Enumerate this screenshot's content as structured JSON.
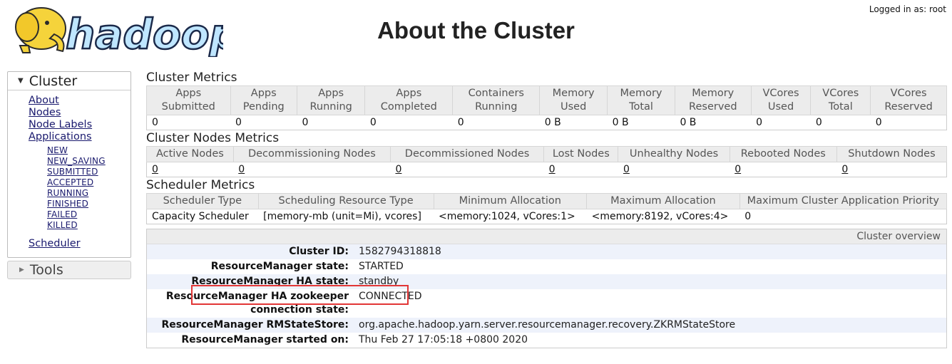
{
  "header": {
    "logo_text": "hadoop",
    "title": "About the Cluster",
    "logged_in": "Logged in as: root"
  },
  "sidebar": {
    "cluster_title": "Cluster",
    "links": [
      "About",
      "Nodes",
      "Node Labels",
      "Applications"
    ],
    "app_states": [
      "NEW",
      "NEW_SAVING",
      "SUBMITTED",
      "ACCEPTED",
      "RUNNING",
      "FINISHED",
      "FAILED",
      "KILLED"
    ],
    "scheduler_link": "Scheduler",
    "tools_title": "Tools"
  },
  "cluster_metrics": {
    "title": "Cluster Metrics",
    "headers": [
      [
        "Apps",
        "Submitted"
      ],
      [
        "Apps",
        "Pending"
      ],
      [
        "Apps",
        "Running"
      ],
      [
        "Apps",
        "Completed"
      ],
      [
        "Containers",
        "Running"
      ],
      [
        "Memory",
        "Used"
      ],
      [
        "Memory",
        "Total"
      ],
      [
        "Memory",
        "Reserved"
      ],
      [
        "VCores",
        "Used"
      ],
      [
        "VCores",
        "Total"
      ],
      [
        "VCores",
        "Reserved"
      ]
    ],
    "values": [
      "0",
      "0",
      "0",
      "0",
      "0",
      "0 B",
      "0 B",
      "0 B",
      "0",
      "0",
      "0"
    ]
  },
  "node_metrics": {
    "title": "Cluster Nodes Metrics",
    "headers": [
      "Active Nodes",
      "Decommissioning Nodes",
      "Decommissioned Nodes",
      "Lost Nodes",
      "Unhealthy Nodes",
      "Rebooted Nodes",
      "Shutdown Nodes"
    ],
    "values": [
      "0",
      "0",
      "0",
      "0",
      "0",
      "0",
      "0"
    ]
  },
  "scheduler_metrics": {
    "title": "Scheduler Metrics",
    "headers": [
      "Scheduler Type",
      "Scheduling Resource Type",
      "Minimum Allocation",
      "Maximum Allocation",
      "Maximum Cluster Application Priority"
    ],
    "values": [
      "Capacity Scheduler",
      "[memory-mb (unit=Mi), vcores]",
      "<memory:1024, vCores:1>",
      "<memory:8192, vCores:4>",
      "0"
    ]
  },
  "overview": {
    "title": "Cluster overview",
    "rows": [
      {
        "key": "Cluster ID:",
        "value": "1582794318818"
      },
      {
        "key": "ResourceManager state:",
        "value": "STARTED"
      },
      {
        "key": "ResourceManager HA state:",
        "value": "standby"
      },
      {
        "key": "ResourceManager HA zookeeper connection state:",
        "value": "CONNECTED"
      },
      {
        "key": "ResourceManager RMStateStore:",
        "value": "org.apache.hadoop.yarn.server.resourcemanager.recovery.ZKRMStateStore"
      },
      {
        "key": "ResourceManager started on:",
        "value": "Thu Feb 27 17:05:18 +0800 2020"
      }
    ]
  },
  "colors": {
    "highlight": "#e23636",
    "logo_blue": "#2a86d6",
    "logo_yellow": "#f5d33b"
  }
}
